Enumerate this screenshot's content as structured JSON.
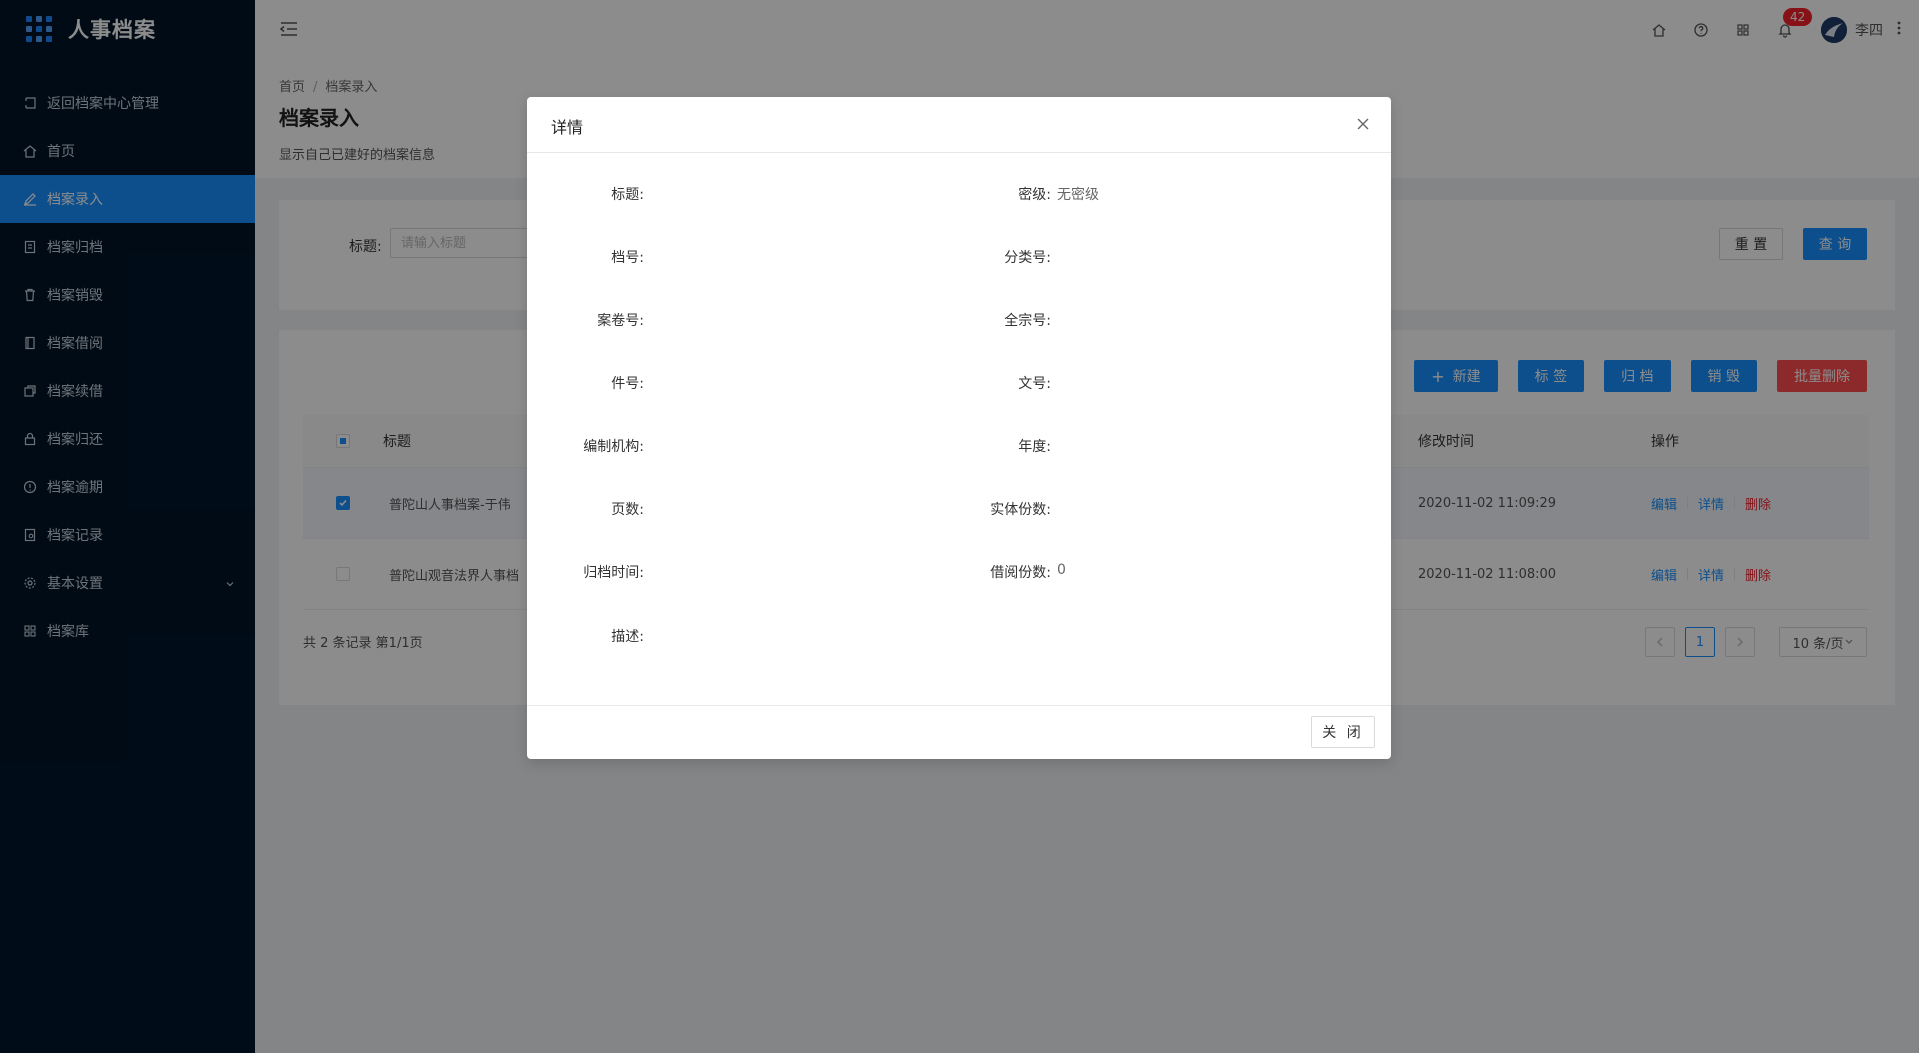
{
  "app": {
    "title": "人事档案"
  },
  "sidebar": {
    "items": [
      {
        "label": "返回档案中心管理",
        "icon": "return-icon"
      },
      {
        "label": "首页",
        "icon": "home-icon"
      },
      {
        "label": "档案录入",
        "icon": "edit-icon",
        "active": true
      },
      {
        "label": "档案归档",
        "icon": "archive-icon"
      },
      {
        "label": "档案销毁",
        "icon": "trash-icon"
      },
      {
        "label": "档案借阅",
        "icon": "book-icon"
      },
      {
        "label": "档案续借",
        "icon": "copy-icon"
      },
      {
        "label": "档案归还",
        "icon": "lock-icon"
      },
      {
        "label": "档案逾期",
        "icon": "warning-icon"
      },
      {
        "label": "档案记录",
        "icon": "record-icon"
      },
      {
        "label": "基本设置",
        "icon": "gear-icon",
        "submenu": true
      },
      {
        "label": "档案库",
        "icon": "grid-icon"
      }
    ]
  },
  "header": {
    "notification_count": "42",
    "username": "李四"
  },
  "breadcrumb": {
    "home": "首页",
    "current": "档案录入"
  },
  "page": {
    "title": "档案录入",
    "description": "显示自己已建好的档案信息"
  },
  "search": {
    "title_label": "标题:",
    "title_placeholder": "请输入标题",
    "reset_label": "重 置",
    "query_label": "查 询"
  },
  "toolbar": {
    "new_label": "新建",
    "tag_label": "标 签",
    "archive_label": "归 档",
    "destroy_label": "销 毁",
    "batch_delete_label": "批量删除"
  },
  "table": {
    "columns": {
      "title": "标题",
      "modified": "修改时间",
      "actions": "操作"
    },
    "rows": [
      {
        "title": "普陀山人事档案-于伟",
        "modified": "2020-11-02 11:09:29",
        "checked": true
      },
      {
        "title": "普陀山观音法界人事档",
        "modified": "2020-11-02 11:08:00",
        "checked": false
      }
    ],
    "action_labels": {
      "edit": "编辑",
      "detail": "详情",
      "delete": "删除"
    },
    "footer": "共 2 条记录 第1/1页",
    "page": "1",
    "page_size": "10 条/页"
  },
  "modal": {
    "title": "详情",
    "close_label": "关 闭",
    "fields_left": [
      {
        "label": "标题:",
        "value": ""
      },
      {
        "label": "档号:",
        "value": ""
      },
      {
        "label": "案卷号:",
        "value": ""
      },
      {
        "label": "件号:",
        "value": ""
      },
      {
        "label": "编制机构:",
        "value": ""
      },
      {
        "label": "页数:",
        "value": ""
      },
      {
        "label": "归档时间:",
        "value": ""
      },
      {
        "label": "描述:",
        "value": ""
      }
    ],
    "fields_right": [
      {
        "label": "密级:",
        "value": "无密级"
      },
      {
        "label": "分类号:",
        "value": ""
      },
      {
        "label": "全宗号:",
        "value": ""
      },
      {
        "label": "文号:",
        "value": ""
      },
      {
        "label": "年度:",
        "value": ""
      },
      {
        "label": "实体份数:",
        "value": ""
      },
      {
        "label": "借阅份数:",
        "value": "0"
      }
    ]
  }
}
